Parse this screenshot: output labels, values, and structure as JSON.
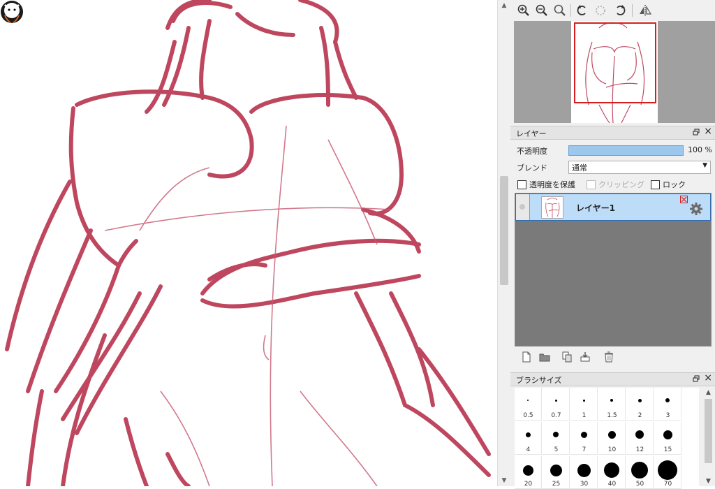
{
  "panels": {
    "layer": {
      "title": "レイヤー",
      "opacity_label": "不透明度",
      "opacity_value": "100 %",
      "opacity_percent": 100,
      "blend_label": "ブレンド",
      "blend_value": "通常",
      "protect_alpha_label": "透明度を保護",
      "clipping_label": "クリッピング",
      "lock_label": "ロック",
      "layers": [
        {
          "name": "レイヤー1",
          "selected": true
        }
      ]
    },
    "brush_size": {
      "title": "ブラシサイズ",
      "sizes": [
        "0.5",
        "0.7",
        "1",
        "1.5",
        "2",
        "3",
        "4",
        "5",
        "7",
        "10",
        "12",
        "15",
        "20",
        "25",
        "30",
        "40",
        "50",
        "70"
      ]
    }
  },
  "icons": {
    "navigator_toolbar": [
      "zoom-in-icon",
      "zoom-out-icon",
      "zoom-reset-icon",
      "rotate-left-icon",
      "rotate-reset-icon",
      "rotate-right-icon",
      "flip-horizontal-icon"
    ],
    "layer_toolbar": [
      "new-layer-icon",
      "new-folder-icon",
      "duplicate-layer-icon",
      "merge-down-icon",
      "delete-layer-icon"
    ]
  },
  "colors": {
    "sketch_stroke": "#b8344e",
    "selection_frame": "#d42020",
    "selected_layer_bg": "#bcdcf7"
  }
}
